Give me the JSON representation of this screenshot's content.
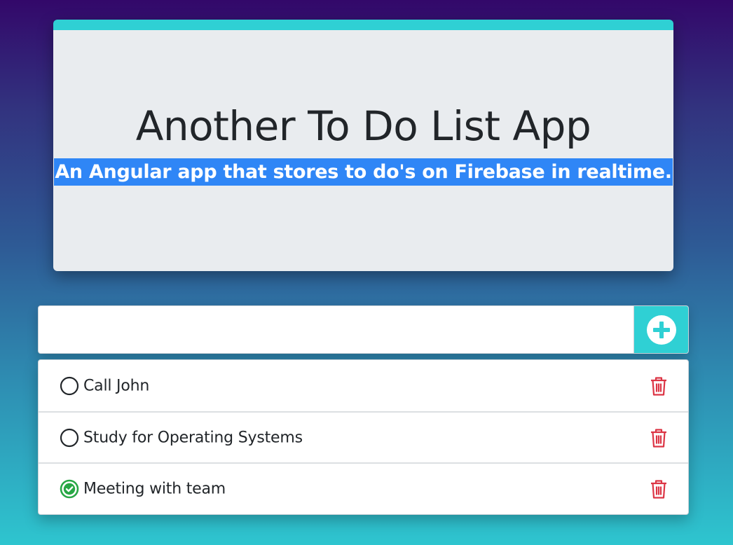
{
  "header": {
    "title": "Another To Do List App",
    "subtitle": "An Angular app that stores to do's on Firebase in realtime."
  },
  "add_todo": {
    "input_value": "",
    "button_icon": "plus-circle-icon"
  },
  "todos": [
    {
      "text": "Call John",
      "done": false,
      "status_icon": "circle-outline-icon",
      "delete_icon": "trash-icon"
    },
    {
      "text": "Study for Operating Systems",
      "done": false,
      "status_icon": "circle-outline-icon",
      "delete_icon": "trash-icon"
    },
    {
      "text": "Meeting with team",
      "done": true,
      "status_icon": "check-circle-icon",
      "delete_icon": "trash-icon"
    }
  ],
  "colors": {
    "accent": "#2fd0d4",
    "selection": "#2f86f6",
    "done": "#28a745",
    "delete": "#dc3545"
  }
}
